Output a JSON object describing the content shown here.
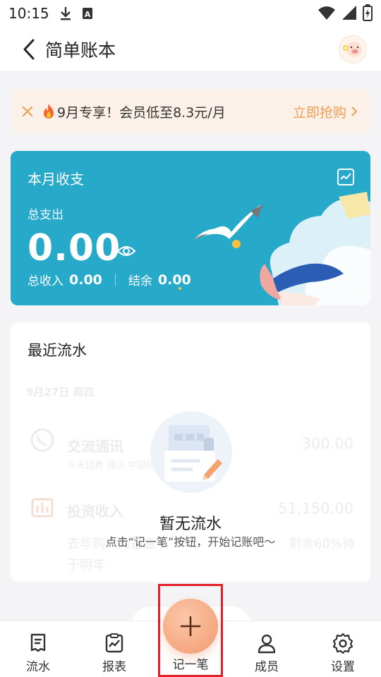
{
  "status_bar": {
    "time": "10:15"
  },
  "header": {
    "title": "简单账本"
  },
  "promo": {
    "text": "9月专享！会员低至8.3元/月",
    "cta": "立即抢购"
  },
  "summary": {
    "title": "本月收支",
    "expense_label": "总支出",
    "expense_amount": "0.00",
    "income_label": "总收入",
    "income_amount": "0.00",
    "balance_label": "结余",
    "balance_amount": "0.00"
  },
  "recent": {
    "title": "最近流水",
    "placeholder": {
      "date": "9月27日  周四",
      "row1_name": "交流通讯",
      "row1_amount": "300.00",
      "row1_sub": "今天话费      通讯      中国移动",
      "row2_name": "投资收入",
      "row2_amount": "51,150.00",
      "row2_sub1": "去年购入的基金",
      "row2_sub2": "剩余60%待",
      "row2_sub3": "于明年"
    },
    "empty_title": "暂无流水",
    "empty_subtitle": "点击“记一笔”按钮，开始记账吧～"
  },
  "nav": {
    "flow": "流水",
    "report": "报表",
    "add": "记一笔",
    "members": "成员",
    "settings": "设置"
  },
  "colors": {
    "accent_orange": "#eaa054",
    "card_blue": "#27a9c9",
    "add_button": "#f29a6f",
    "highlight": "#e3202a"
  },
  "icons": [
    "download-icon",
    "sim-icon",
    "wifi-icon",
    "signal-icon",
    "battery-icon",
    "back-icon",
    "avatar-pig-icon",
    "close-icon",
    "fire-icon",
    "chevron-right-icon",
    "chart-icon",
    "eye-icon",
    "receipt-icon",
    "report-icon",
    "plus-icon",
    "person-icon",
    "gear-icon"
  ]
}
